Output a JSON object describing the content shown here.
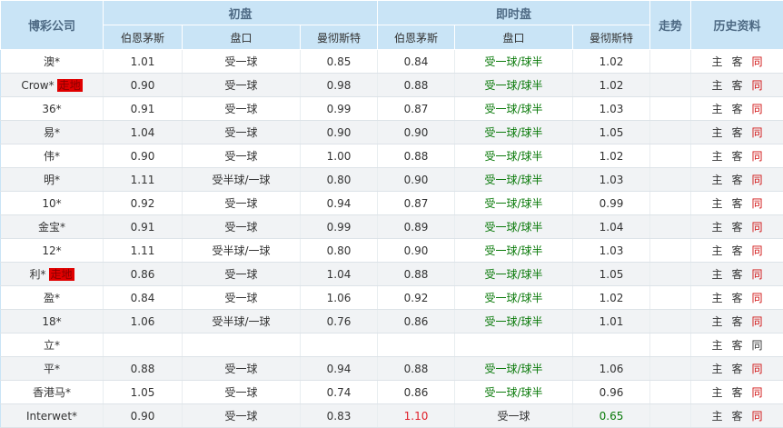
{
  "headers": {
    "company": "博彩公司",
    "initial": "初盘",
    "live": "即时盘",
    "trend": "走势",
    "history": "历史资料",
    "sub": [
      "伯恩茅斯",
      "盘口",
      "曼彻斯特",
      "伯恩茅斯",
      "盘口",
      "曼彻斯特"
    ]
  },
  "history_labels": {
    "home": "主",
    "away": "客",
    "same": "同"
  },
  "rows": [
    {
      "name": "澳*",
      "badge": "",
      "i1": "1.01",
      "ih": "受一球",
      "i2": "0.85",
      "l1": "0.84",
      "lh": "受一球/球半",
      "l2": "1.02"
    },
    {
      "name": "Crow*",
      "badge": "走地",
      "i1": "0.90",
      "ih": "受一球",
      "i2": "0.98",
      "l1": "0.88",
      "lh": "受一球/球半",
      "l2": "1.02"
    },
    {
      "name": "36*",
      "badge": "",
      "i1": "0.91",
      "ih": "受一球",
      "i2": "0.99",
      "l1": "0.87",
      "lh": "受一球/球半",
      "l2": "1.03"
    },
    {
      "name": "易*",
      "badge": "",
      "i1": "1.04",
      "ih": "受一球",
      "i2": "0.90",
      "l1": "0.90",
      "lh": "受一球/球半",
      "l2": "1.05"
    },
    {
      "name": "伟*",
      "badge": "",
      "i1": "0.90",
      "ih": "受一球",
      "i2": "1.00",
      "l1": "0.88",
      "lh": "受一球/球半",
      "l2": "1.02"
    },
    {
      "name": "明*",
      "badge": "",
      "i1": "1.11",
      "ih": "受半球/一球",
      "i2": "0.80",
      "l1": "0.90",
      "lh": "受一球/球半",
      "l2": "1.03"
    },
    {
      "name": "10*",
      "badge": "",
      "i1": "0.92",
      "ih": "受一球",
      "i2": "0.94",
      "l1": "0.87",
      "lh": "受一球/球半",
      "l2": "0.99"
    },
    {
      "name": "金宝*",
      "badge": "",
      "i1": "0.91",
      "ih": "受一球",
      "i2": "0.99",
      "l1": "0.89",
      "lh": "受一球/球半",
      "l2": "1.04"
    },
    {
      "name": "12*",
      "badge": "",
      "i1": "1.11",
      "ih": "受半球/一球",
      "i2": "0.80",
      "l1": "0.90",
      "lh": "受一球/球半",
      "l2": "1.03"
    },
    {
      "name": "利*",
      "badge": "走地",
      "i1": "0.86",
      "ih": "受一球",
      "i2": "1.04",
      "l1": "0.88",
      "lh": "受一球/球半",
      "l2": "1.05"
    },
    {
      "name": "盈*",
      "badge": "",
      "i1": "0.84",
      "ih": "受一球",
      "i2": "1.06",
      "l1": "0.92",
      "lh": "受一球/球半",
      "l2": "1.02"
    },
    {
      "name": "18*",
      "badge": "",
      "i1": "1.06",
      "ih": "受半球/一球",
      "i2": "0.76",
      "l1": "0.86",
      "lh": "受一球/球半",
      "l2": "1.01"
    },
    {
      "name": "立*",
      "badge": "",
      "i1": "",
      "ih": "",
      "i2": "",
      "l1": "",
      "lh": "",
      "l2": "",
      "plain": true
    },
    {
      "name": "平*",
      "badge": "",
      "i1": "0.88",
      "ih": "受一球",
      "i2": "0.94",
      "l1": "0.88",
      "lh": "受一球/球半",
      "l2": "1.06"
    },
    {
      "name": "香港马*",
      "badge": "",
      "i1": "1.05",
      "ih": "受一球",
      "i2": "0.74",
      "l1": "0.86",
      "lh": "受一球/球半",
      "l2": "0.96"
    },
    {
      "name": "Interwet*",
      "badge": "",
      "i1": "0.90",
      "ih": "受一球",
      "i2": "0.83",
      "l1": "1.10",
      "lh": "受一球",
      "l2": "0.65",
      "l1c": "r",
      "lhc": "",
      "l2c": "g"
    }
  ]
}
